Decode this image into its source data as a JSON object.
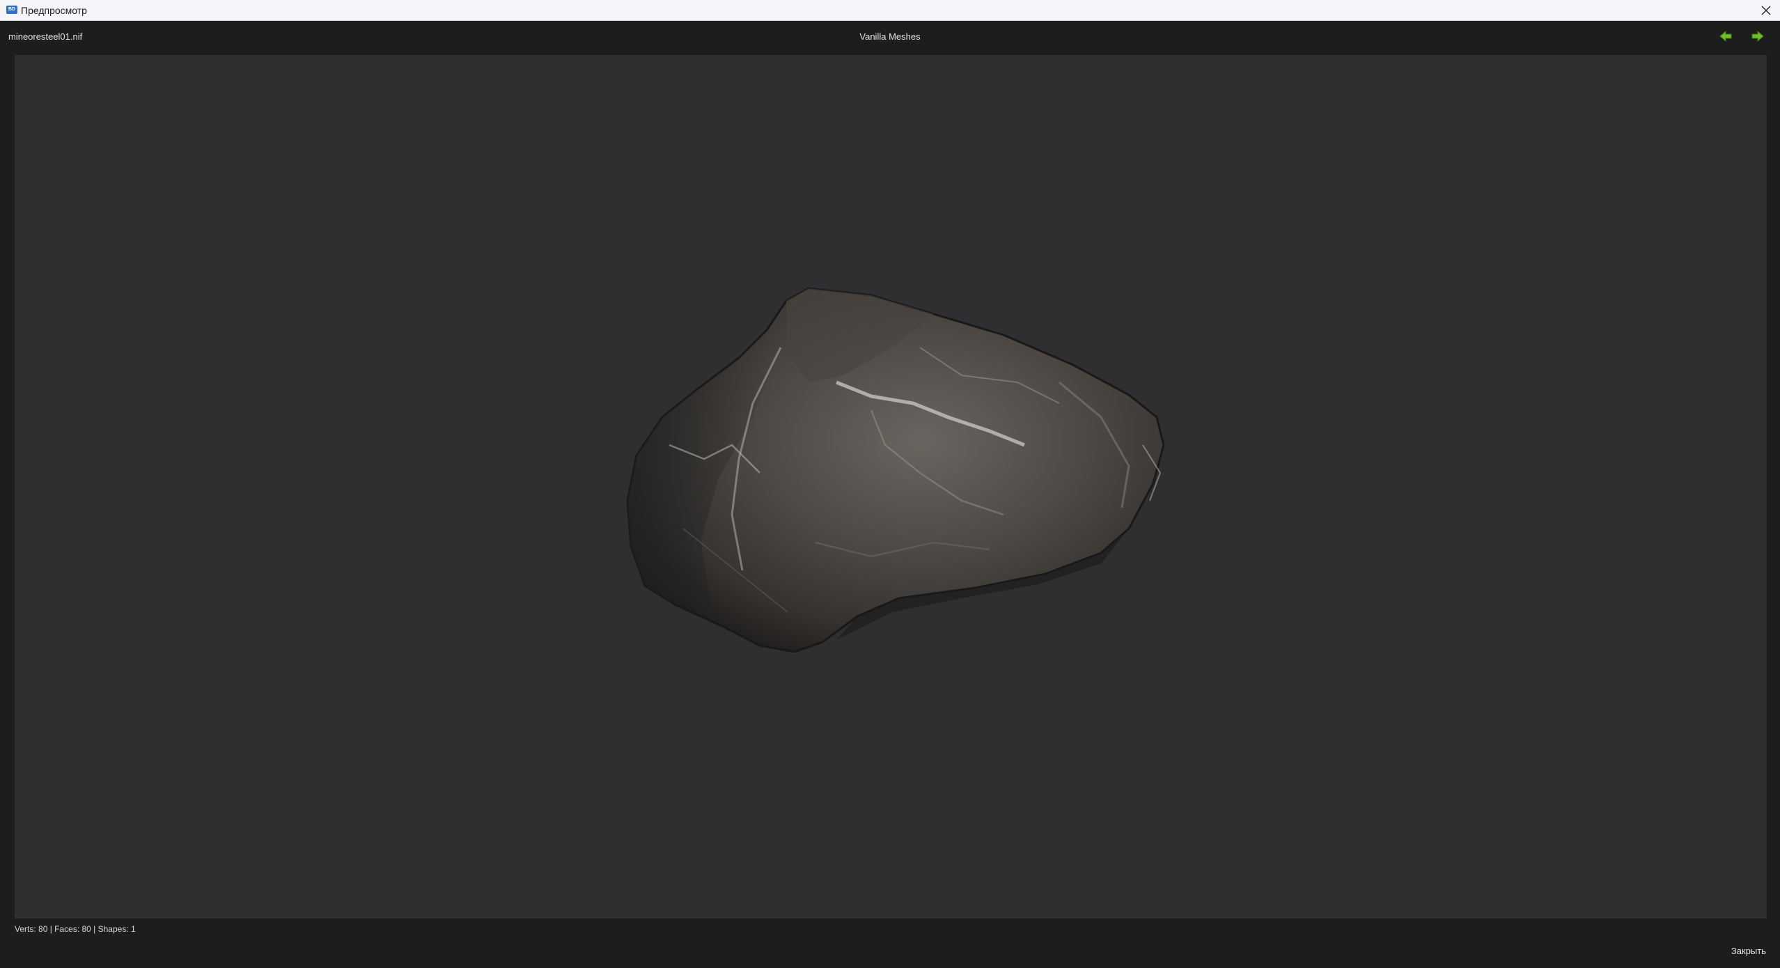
{
  "window": {
    "title": "Предпросмотр",
    "app_icon": "app-icon"
  },
  "header": {
    "file_name": "mineoresteel01.nif",
    "source": "Vanilla Meshes",
    "prev_icon": "arrow-left-icon",
    "next_icon": "arrow-right-icon",
    "accent": "#6fbf2a"
  },
  "viewport": {
    "background": "#2f2f31",
    "model": "rock-mesh"
  },
  "status": {
    "stats": "Verts: 80 | Faces: 80 | Shapes: 1"
  },
  "footer": {
    "close_label": "Закрыть"
  }
}
